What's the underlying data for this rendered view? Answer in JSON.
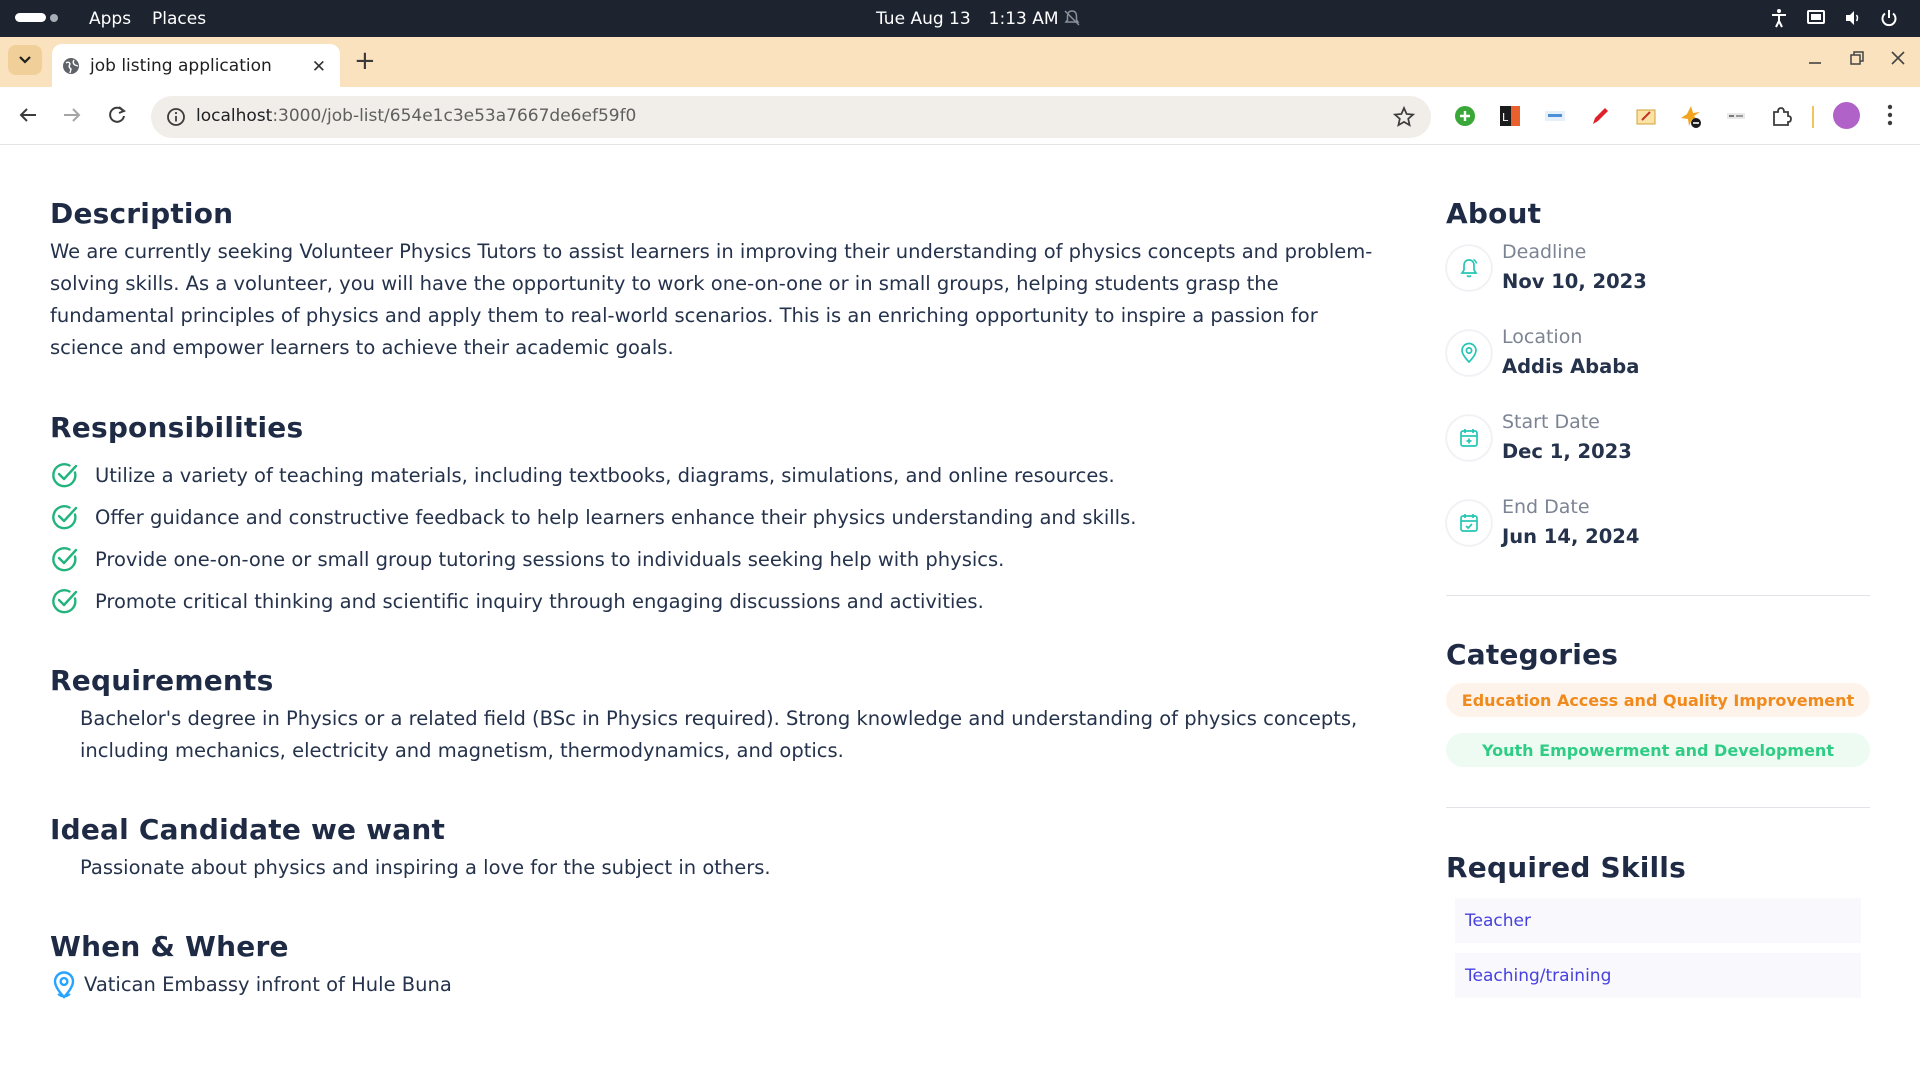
{
  "os_bar": {
    "apps_label": "Apps",
    "places_label": "Places",
    "date": "Tue Aug 13",
    "time": "1:13 AM"
  },
  "browser": {
    "tab_title": "job listing application",
    "url_host": "localhost",
    "url_path": ":3000/job-list/654e1c3e53a7667de6ef59f0"
  },
  "description": {
    "heading": "Description",
    "text": "We are currently seeking Volunteer Physics Tutors to assist learners in improving their understanding of physics concepts and problem-solving skills. As a volunteer, you will have the opportunity to work one-on-one or in small groups, helping students grasp the fundamental principles of physics and apply them to real-world scenarios. This is an enriching opportunity to inspire a passion for science and empower learners to achieve their academic goals."
  },
  "responsibilities": {
    "heading": "Responsibilities",
    "items": [
      "Utilize a variety of teaching materials, including textbooks, diagrams, simulations, and online resources.",
      "Offer guidance and constructive feedback to help learners enhance their physics understanding and skills.",
      "Provide one-on-one or small group tutoring sessions to individuals seeking help with physics.",
      "Promote critical thinking and scientific inquiry through engaging discussions and activities."
    ]
  },
  "requirements": {
    "heading": "Requirements",
    "text": "Bachelor's degree in Physics or a related field (BSc in Physics required). Strong knowledge and understanding of physics concepts, including mechanics, electricity and magnetism, thermodynamics, and optics."
  },
  "ideal_candidate": {
    "heading": "Ideal Candidate we want",
    "text": "Passionate about physics and inspiring a love for the subject in others."
  },
  "when_where": {
    "heading": "When & Where",
    "location": "Vatican Embassy infront of Hule Buna"
  },
  "about": {
    "heading": "About",
    "items": [
      {
        "label": "Deadline",
        "value": "Nov 10, 2023",
        "icon": "bell-icon"
      },
      {
        "label": "Location",
        "value": "Addis Ababa",
        "icon": "location-pin-icon"
      },
      {
        "label": "Start Date",
        "value": "Dec 1, 2023",
        "icon": "calendar-plus-icon"
      },
      {
        "label": "End Date",
        "value": "Jun 14, 2024",
        "icon": "calendar-check-icon"
      }
    ]
  },
  "categories": {
    "heading": "Categories",
    "items": [
      {
        "label": "Education Access and Quality Improvement",
        "color": "#ffb836",
        "text_color": "#f08a1c",
        "bg": "#fdf3ea"
      },
      {
        "label": "Youth Empowerment and Development",
        "color": "#56cdad",
        "text_color": "#2fcd84",
        "bg": "#eefbf3"
      }
    ]
  },
  "skills": {
    "heading": "Required Skills",
    "items": [
      "Teacher",
      "Teaching/training"
    ]
  },
  "colors": {
    "accent": "#26a4ff",
    "check_green": "#56cdad",
    "heading": "#1f2b45",
    "tab_strip": "#f9e2bd",
    "skill_text": "#4640de"
  }
}
